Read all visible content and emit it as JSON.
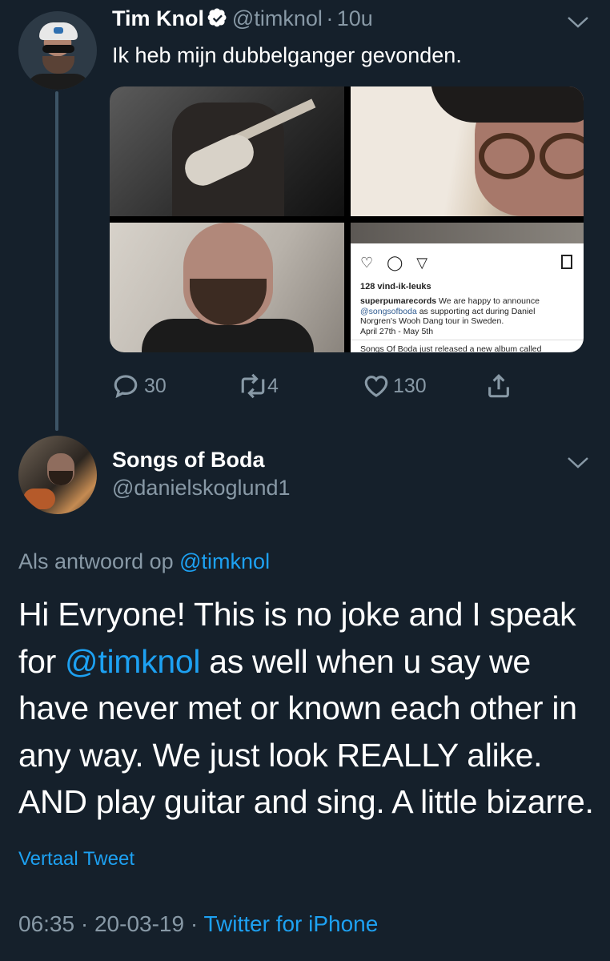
{
  "tweet1": {
    "name": "Tim Knol",
    "handle": "@timknol",
    "separator": "·",
    "time": "10u",
    "text": "Ik heb mijn dubbelganger gevonden.",
    "media_post": {
      "icons": "♡ ◯ ▽",
      "likes": "128 vind-ik-leuks",
      "account": "superpumarecords",
      "caption_1": " We are happy to announce ",
      "mention": "@songsofboda",
      "caption_2": " as supporting act during Daniel Norgren's Wooh Dang tour in Sweden.",
      "dates": "April 27th - May 5th",
      "more": "Songs Of Boda just released a new album called"
    },
    "actions": {
      "replies": "30",
      "retweets": "4",
      "likes": "130"
    }
  },
  "tweet2": {
    "name": "Songs of Boda",
    "handle": "@danielskoglund1",
    "reply_prefix": "Als antwoord op",
    "reply_to": "@timknol",
    "text_1": "Hi Evryone! This is no joke and I speak for ",
    "text_mention": "@timknol",
    "text_2": " as well when u say we have never met or known each other in any way. We just look REALLY alike. AND play guitar and sing. A little bizarre.",
    "translate": "Vertaal Tweet",
    "time": "06:35",
    "separator": "·",
    "date": "20-03-19",
    "source": "Twitter for iPhone"
  },
  "colors": {
    "background": "#15202b",
    "text": "#ffffff",
    "muted": "#8899a6",
    "accent": "#1da1f2"
  }
}
